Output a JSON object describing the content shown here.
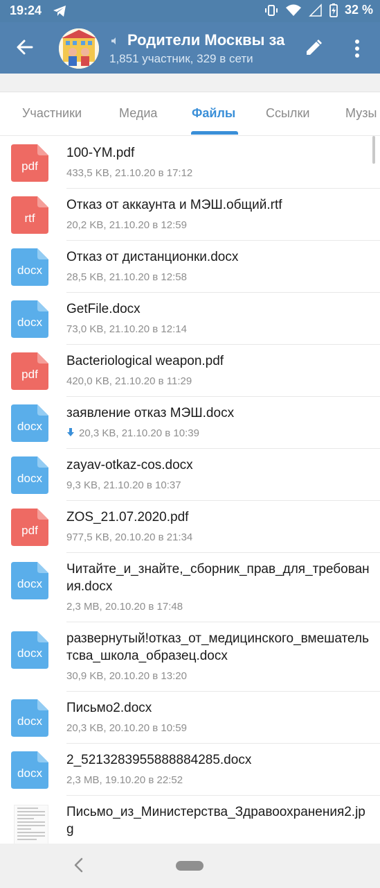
{
  "status_bar": {
    "time": "19:24",
    "battery": "32 %",
    "icons": [
      "telegram-icon",
      "vibrate-icon",
      "wifi-icon",
      "signal-icon",
      "battery-icon"
    ]
  },
  "header": {
    "title": "Родители Москвы за",
    "subtitle": "1,851 участник, 329 в сети",
    "icons": [
      "back-arrow-icon",
      "edit-pencil-icon",
      "more-vert-icon"
    ]
  },
  "tabs": [
    {
      "label": "Участники"
    },
    {
      "label": "Медиа"
    },
    {
      "label": "Файлы",
      "active": true
    },
    {
      "label": "Ссылки"
    },
    {
      "label": "Музы"
    }
  ],
  "files": [
    {
      "name": "100-YM.pdf",
      "meta": "433,5 KB, 21.10.20 в 17:12",
      "ext": "pdf"
    },
    {
      "name": "Отказ от аккаунта и МЭШ.общий.rtf",
      "meta": "20,2 KB, 21.10.20 в 12:59",
      "ext": "rtf"
    },
    {
      "name": "Отказ от дистанционки.docx",
      "meta": "28,5 KB, 21.10.20 в 12:58",
      "ext": "docx"
    },
    {
      "name": "GetFile.docx",
      "meta": "73,0 KB, 21.10.20 в 12:14",
      "ext": "docx"
    },
    {
      "name": "Bacteriological weapon.pdf",
      "meta": "420,0 KB, 21.10.20 в 11:29",
      "ext": "pdf"
    },
    {
      "name": "заявление отказ МЭШ.docx",
      "meta": "20,3 KB, 21.10.20 в 10:39",
      "ext": "docx",
      "downloaded": true
    },
    {
      "name": "zayav-otkaz-cos.docx",
      "meta": "9,3 KB, 21.10.20 в 10:37",
      "ext": "docx"
    },
    {
      "name": "ZOS_21.07.2020.pdf",
      "meta": "977,5 KB, 20.10.20 в 21:34",
      "ext": "pdf"
    },
    {
      "name": "Читайте_и_знайте,_сборник_прав_для_требования.docx",
      "meta": "2,3 MB, 20.10.20 в 17:48",
      "ext": "docx"
    },
    {
      "name": "развернутый!отказ_от_медицинского_вмешательтсва_школа_образец.docx",
      "meta": "30,9 KB, 20.10.20 в 13:20",
      "ext": "docx"
    },
    {
      "name": "Письмо2.docx",
      "meta": "20,3 KB, 20.10.20 в 10:59",
      "ext": "docx"
    },
    {
      "name": "2_5213283955888884285.docx",
      "meta": "2,3 MB, 19.10.20 в 22:52",
      "ext": "docx"
    },
    {
      "name": "Письмо_из_Министерства_Здравоохранения2.jpg",
      "meta": "",
      "ext": "jpg"
    }
  ],
  "colors": {
    "header_bg": "#5282b1",
    "accent": "#3a8fd8",
    "pdf_icon": "#ee6a63",
    "docx_icon": "#5aaeea"
  }
}
